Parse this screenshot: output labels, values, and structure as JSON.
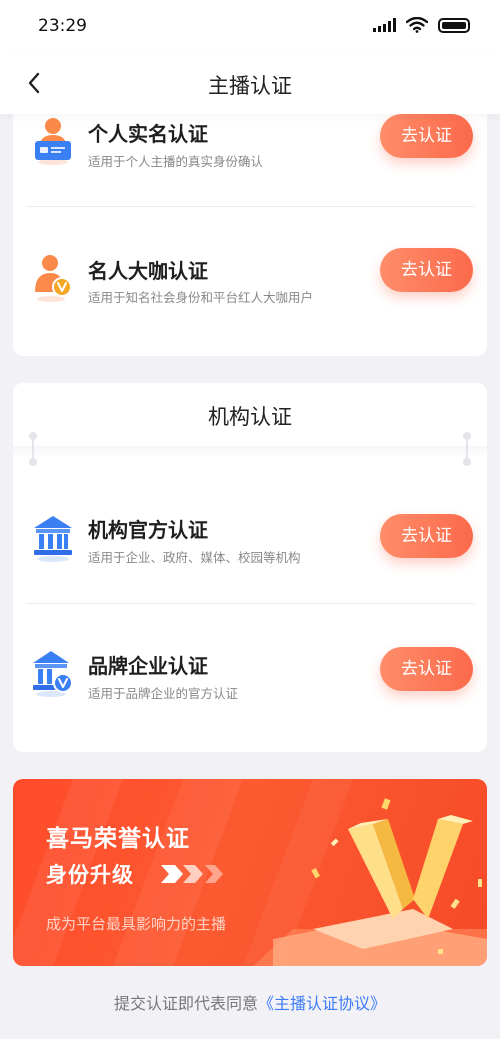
{
  "status_bar": {
    "time": "23:29"
  },
  "nav": {
    "title": "主播认证"
  },
  "personal": {
    "items": [
      {
        "title": "个人实名认证",
        "subtitle": "适用于个人主播的真实身份确认",
        "button": "去认证"
      },
      {
        "title": "名人大咖认证",
        "subtitle": "适用于知名社会身份和平台红人大咖用户",
        "button": "去认证"
      }
    ]
  },
  "organization": {
    "title": "机构认证",
    "items": [
      {
        "title": "机构官方认证",
        "subtitle": "适用于企业、政府、媒体、校园等机构",
        "button": "去认证"
      },
      {
        "title": "品牌企业认证",
        "subtitle": "适用于品牌企业的官方认证",
        "button": "去认证"
      }
    ]
  },
  "banner": {
    "title": "喜马荣誉认证",
    "subtitle": "身份升级",
    "description": "成为平台最具影响力的主播"
  },
  "footer": {
    "prefix": "提交认证即代表同意",
    "link": "《主播认证协议》"
  },
  "colors": {
    "accent": "#fb6a4b",
    "link": "#3d7bf7",
    "banner": "#fc5a31"
  }
}
